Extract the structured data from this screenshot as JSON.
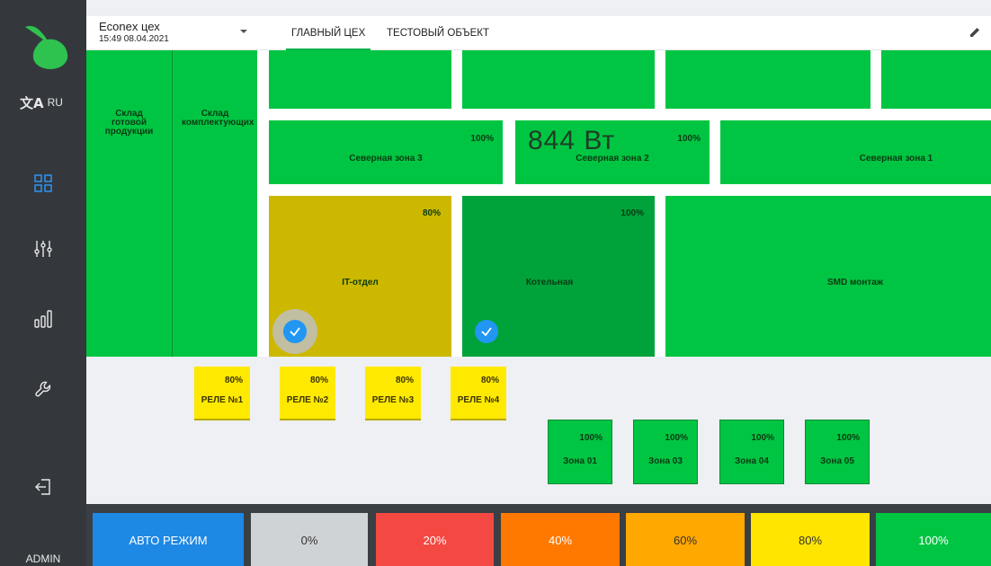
{
  "sidebar": {
    "lang_code": "RU",
    "lang_icon": "translate-icon",
    "nav": [
      {
        "icon": "dashboard-grid-icon"
      },
      {
        "icon": "sliders-icon"
      },
      {
        "icon": "bar-chart-icon"
      },
      {
        "icon": "wrench-icon"
      },
      {
        "icon": "logout-icon"
      }
    ],
    "user": "ADMIN"
  },
  "header": {
    "org_name": "Econex цех",
    "datetime": "15:49 08.04.2021",
    "tabs": [
      {
        "label": "ГЛАВНЫЙ ЦЕХ",
        "active": true
      },
      {
        "label": "ТЕСТОВЫЙ ОБЪЕКТ",
        "active": false
      }
    ]
  },
  "zones": {
    "sklad_gotovoy": "Склад готовой продукции",
    "sklad_komplekt": "Склад комплектующих",
    "north3": {
      "name": "Северная зона 3",
      "pct": "100%"
    },
    "north2": {
      "name": "Северная зона 2",
      "pct": "100%",
      "power": "844 Вт"
    },
    "north1": {
      "name": "Северная зона 1"
    },
    "it": {
      "name": "IT-отдел",
      "pct": "80%"
    },
    "kotelnaya": {
      "name": "Котельная",
      "pct": "100%"
    },
    "smd": {
      "name": "SMD монтаж"
    }
  },
  "relays": [
    {
      "pct": "80%",
      "name": "РЕЛЕ №1"
    },
    {
      "pct": "80%",
      "name": "РЕЛЕ №2"
    },
    {
      "pct": "80%",
      "name": "РЕЛЕ №3"
    },
    {
      "pct": "80%",
      "name": "РЕЛЕ №4"
    }
  ],
  "mini_zones": [
    {
      "pct": "100%",
      "name": "Зона 01"
    },
    {
      "pct": "100%",
      "name": "Зона 03"
    },
    {
      "pct": "100%",
      "name": "Зона 04"
    },
    {
      "pct": "100%",
      "name": "Зона 05"
    }
  ],
  "modes": [
    {
      "label": "АВТО РЕЖИМ",
      "color": "#1e88e5"
    },
    {
      "label": "0%",
      "color": "#cfd3d6"
    },
    {
      "label": "20%",
      "color": "#f44842"
    },
    {
      "label": "40%",
      "color": "#ff7800"
    },
    {
      "label": "60%",
      "color": "#ffa800"
    },
    {
      "label": "80%",
      "color": "#ffe500"
    },
    {
      "label": "100%",
      "color": "#00c542"
    }
  ],
  "colors": {
    "sidebar": "#34383d",
    "accent_green": "#00c542",
    "zone_yellow": "#ccb800",
    "zone_dark_green": "#00a33a",
    "relay_yellow": "#ffe900",
    "check_blue": "#2196f3"
  }
}
